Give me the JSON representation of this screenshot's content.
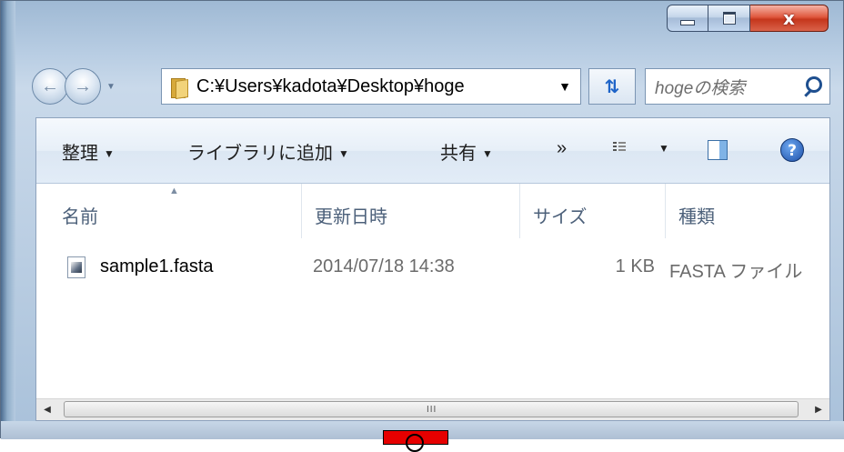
{
  "window": {
    "caption": {
      "minimize": "minimize",
      "maximize": "maximize",
      "close": "x"
    }
  },
  "nav": {
    "address": "C:¥Users¥kadota¥Desktop¥hoge",
    "search_placeholder": "hogeの検索"
  },
  "toolbar": {
    "organize": "整理",
    "add_to_library": "ライブラリに追加",
    "share": "共有",
    "more": "»"
  },
  "columns": {
    "name": "名前",
    "modified": "更新日時",
    "size": "サイズ",
    "type": "種類"
  },
  "files": [
    {
      "name": "sample1.fasta",
      "modified": "2014/07/18 14:38",
      "size": "1 KB",
      "type": "FASTA ファイル"
    }
  ],
  "scrollbar": {
    "grip": "III"
  },
  "colors": {
    "marker": "#e60000",
    "close_button": "#c5361c"
  },
  "icons": [
    "back-arrow-icon",
    "forward-arrow-icon",
    "folder-icon",
    "refresh-icon",
    "search-icon",
    "view-icon",
    "preview-pane-icon",
    "help-icon",
    "file-icon"
  ]
}
